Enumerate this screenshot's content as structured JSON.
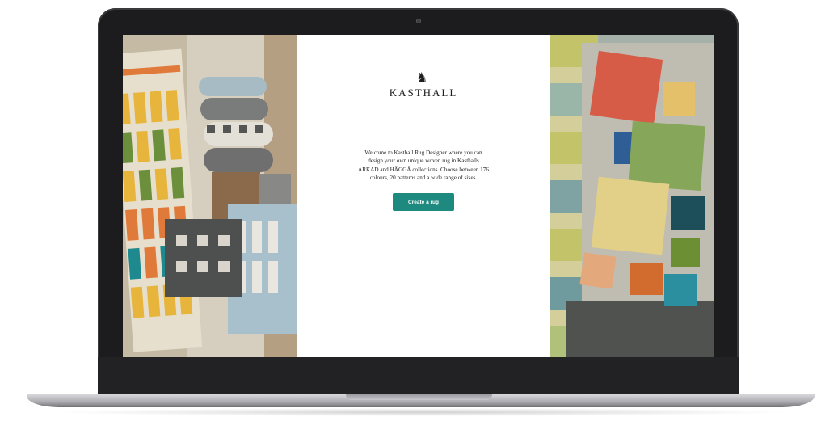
{
  "brand": {
    "name": "KASTHALL",
    "logo_icon": "lion-crest-icon"
  },
  "intro": {
    "text": "Welcome to Kasthall Rug Designer where you can design your own unique woven rug in Kasthalls ARKAD and HÄGGÅ collections. Choose between 176 colours, 20 patterns and a wide range of sizes."
  },
  "cta": {
    "label": "Create a rug",
    "color": "#1e8a7f"
  },
  "colors": {
    "laptop_frame": "#1c1c1e",
    "screen_bg": "#ffffff"
  }
}
